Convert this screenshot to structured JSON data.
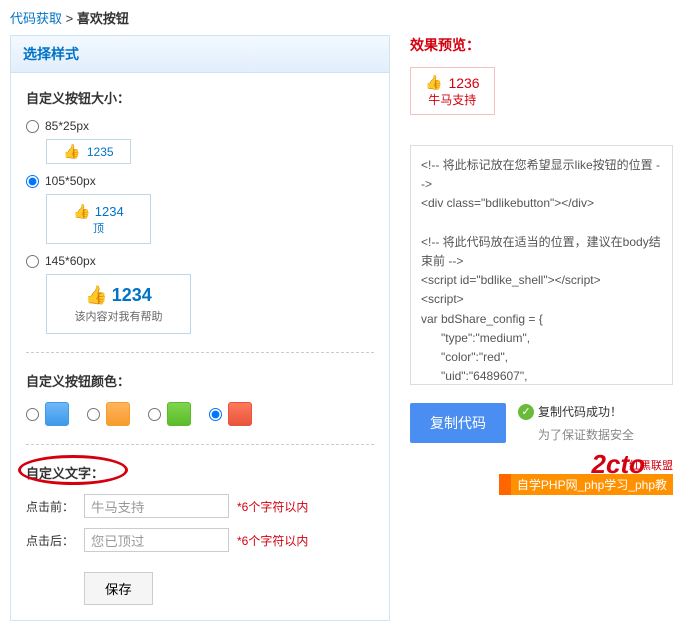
{
  "breadcrumb": {
    "link": "代码获取",
    "current": "喜欢按钮"
  },
  "panel": {
    "title": "选择样式"
  },
  "size": {
    "title": "自定义按钮大小：",
    "opt1": {
      "label": "85*25px",
      "count": "1235"
    },
    "opt2": {
      "label": "105*50px",
      "count": "1234",
      "text": "顶"
    },
    "opt3": {
      "label": "145*60px",
      "count": "1234",
      "text": "该内容对我有帮助"
    }
  },
  "color": {
    "title": "自定义按钮颜色："
  },
  "text": {
    "title": "自定义文字：",
    "before_label": "点击前：",
    "before_value": "牛马支持",
    "after_label": "点击后：",
    "after_value": "您已顶过",
    "hint": "*6个字符以内",
    "save": "保存"
  },
  "preview": {
    "title": "效果预览：",
    "count": "1236",
    "text": "牛马支持"
  },
  "code": "<!-- 将此标记放在您希望显示like按钮的位置 -->\n<div class=\"bdlikebutton\"></div>\n\n<!-- 将此代码放在适当的位置，建议在body结束前 -->\n<script id=\"bdlike_shell\"></script>\n<script>\nvar bdShare_config = {\n      \"type\":\"medium\",\n      \"color\":\"red\",\n      \"uid\":\"6489607\",\n      \"likeText\":\"牛马支持\",\n      \"likedText\":\"您已顶过\"\n};\ndocument.getElementById(\"bdlike_shell\").src=\"ht=\" + Math.ceil(new Date()/3600000);\n</script>",
  "copy": {
    "button": "复制代码",
    "success": "复制代码成功！",
    "note": "为了保证数据安全"
  },
  "logo": {
    "main": "2cto",
    "sub": "红黑联盟"
  },
  "footer": "自学PHP网_php学习_php教"
}
